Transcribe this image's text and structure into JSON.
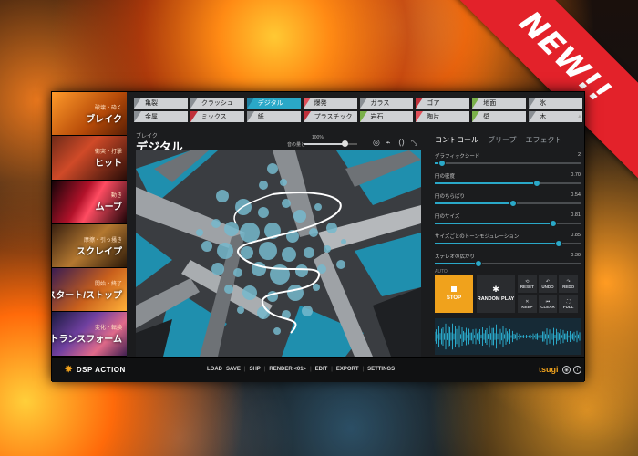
{
  "banner": {
    "text": "NEW!!"
  },
  "sidebar": {
    "items": [
      {
        "sub": "破壊・砕く",
        "label": "ブレイク",
        "active": true
      },
      {
        "sub": "衝突・打撃",
        "label": "ヒット"
      },
      {
        "sub": "動き",
        "label": "ムーブ"
      },
      {
        "sub": "摩擦・引っ掻き",
        "label": "スクレイプ"
      },
      {
        "sub": "開始・終了",
        "label": "スタート/ストップ"
      },
      {
        "sub": "変化・転換",
        "label": "トランスフォーム"
      }
    ]
  },
  "tags": [
    {
      "label": "亀裂",
      "color": "#8a8f94"
    },
    {
      "label": "クラッシュ",
      "color": "#8a8f94"
    },
    {
      "label": "デジタル",
      "color": "#1f7fa0",
      "selected": true
    },
    {
      "label": "爆発",
      "color": "#e0505a"
    },
    {
      "label": "ガラス",
      "color": "#8a8f94"
    },
    {
      "label": "ゴア",
      "color": "#c0303a"
    },
    {
      "label": "地面",
      "color": "#7ab04a"
    },
    {
      "label": "氷",
      "color": "#8a8f94"
    },
    {
      "label": "金属",
      "color": "#8a8f94"
    },
    {
      "label": "ミックス",
      "color": "#c0303a"
    },
    {
      "label": "紙",
      "color": "#8a8f94"
    },
    {
      "label": "プラスチック",
      "color": "#c0303a"
    },
    {
      "label": "岩石",
      "color": "#7ab04a"
    },
    {
      "label": "陶片",
      "color": "#e0505a"
    },
    {
      "label": "壁",
      "color": "#7ab04a"
    },
    {
      "label": "木",
      "color": "#8a8f94"
    }
  ],
  "preset": {
    "category": "ブレイク",
    "name": "デジタル"
  },
  "mix": {
    "label": "音の量と",
    "percent_label": "100%",
    "value": 0.75
  },
  "header_icons": [
    "headphones-icon",
    "waveform-icon",
    "brackets-icon",
    "resize-icon"
  ],
  "panel": {
    "tabs": [
      "コントロール",
      "ブリープ",
      "エフェクト"
    ],
    "params": [
      {
        "label": "グラフィックシード",
        "value_text": "2",
        "value": 0.05
      },
      {
        "label": "円の密度",
        "value_text": "0.70",
        "value": 0.7
      },
      {
        "label": "円のちらばり",
        "value_text": "0.54",
        "value": 0.54
      },
      {
        "label": "円のサイズ",
        "value_text": "0.81",
        "value": 0.81
      },
      {
        "label": "サイズごとのトーンモジュレーション",
        "value_text": "0.85",
        "value": 0.85
      },
      {
        "label": "ステレオの広がり",
        "value_text": "0.30",
        "value": 0.3
      }
    ],
    "auto_label": "AUTO",
    "stop_label": "STOP",
    "random_label": "RANDOM PLAY",
    "small_buttons": [
      {
        "label": "RESET",
        "icon": "reset-icon"
      },
      {
        "label": "UNDO",
        "icon": "undo-icon"
      },
      {
        "label": "REDO",
        "icon": "redo-icon"
      },
      {
        "label": "KEEP",
        "icon": "keep-icon"
      },
      {
        "label": "CLEAR",
        "icon": "clear-icon"
      },
      {
        "label": "FULL",
        "icon": "full-icon"
      }
    ]
  },
  "bottom": {
    "logo": "DSP ACTION",
    "menu": [
      "LOAD",
      "SAVE",
      "SHP",
      "RENDER <01>",
      "EDIT",
      "EXPORT",
      "SETTINGS"
    ],
    "brand": "tsugi"
  },
  "colors": {
    "accent": "#2aa8c8",
    "stop": "#f0a21c",
    "banner": "#e3222a"
  }
}
